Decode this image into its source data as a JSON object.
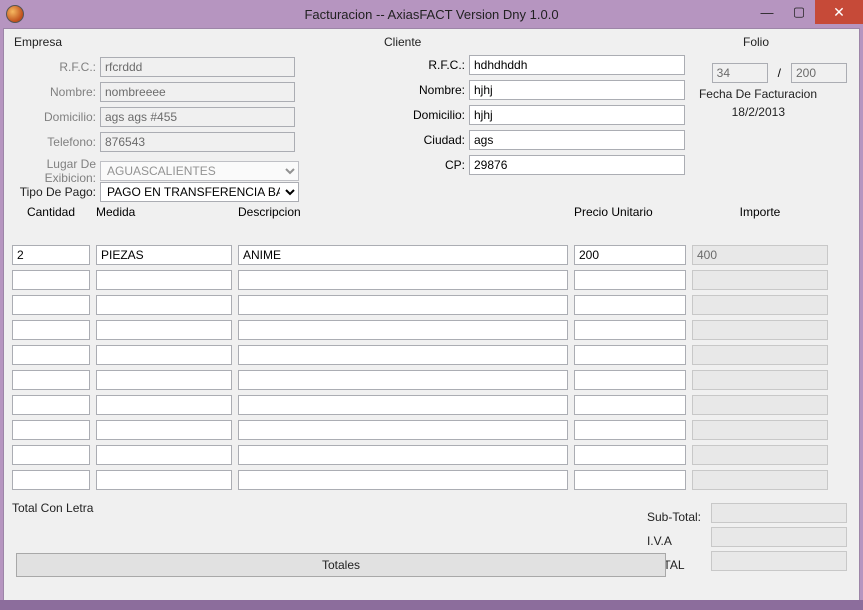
{
  "window": {
    "title": "Facturacion -- AxiasFACT Version Dny 1.0.0"
  },
  "empresa": {
    "heading": "Empresa",
    "rfc_label": "R.F.C.:",
    "rfc": "rfcrddd",
    "nombre_label": "Nombre:",
    "nombre": "nombreeee",
    "domicilio_label": "Domicilio:",
    "domicilio": "ags ags #455",
    "telefono_label": "Telefono:",
    "telefono": "876543",
    "lugar_label": "Lugar De Exibicion:",
    "lugar": "AGUASCALIENTES",
    "tipo_pago_label": "Tipo De Pago:",
    "tipo_pago": "PAGO EN TRANSFERENCIA BANC"
  },
  "cliente": {
    "heading": "Cliente",
    "rfc_label": "R.F.C.:",
    "rfc": "hdhdhddh",
    "nombre_label": "Nombre:",
    "nombre": "hjhj",
    "domicilio_label": "Domicilio:",
    "domicilio": "hjhj",
    "ciudad_label": "Ciudad:",
    "ciudad": "ags",
    "cp_label": "CP:",
    "cp": "29876"
  },
  "folio": {
    "heading": "Folio",
    "a": "34",
    "sep": "/",
    "b": "200",
    "fecha_label": "Fecha De Facturacion",
    "fecha": "18/2/2013"
  },
  "table": {
    "headers": {
      "cantidad": "Cantidad",
      "medida": "Medida",
      "descripcion": "Descripcion",
      "precio_unitario": "Precio Unitario",
      "importe": "Importe"
    },
    "rows": [
      {
        "cantidad": "2",
        "medida": "PIEZAS",
        "descripcion": "ANIME",
        "precio_unitario": "200",
        "importe": "400"
      },
      {
        "cantidad": "",
        "medida": "",
        "descripcion": "",
        "precio_unitario": "",
        "importe": ""
      },
      {
        "cantidad": "",
        "medida": "",
        "descripcion": "",
        "precio_unitario": "",
        "importe": ""
      },
      {
        "cantidad": "",
        "medida": "",
        "descripcion": "",
        "precio_unitario": "",
        "importe": ""
      },
      {
        "cantidad": "",
        "medida": "",
        "descripcion": "",
        "precio_unitario": "",
        "importe": ""
      },
      {
        "cantidad": "",
        "medida": "",
        "descripcion": "",
        "precio_unitario": "",
        "importe": ""
      },
      {
        "cantidad": "",
        "medida": "",
        "descripcion": "",
        "precio_unitario": "",
        "importe": ""
      },
      {
        "cantidad": "",
        "medida": "",
        "descripcion": "",
        "precio_unitario": "",
        "importe": ""
      },
      {
        "cantidad": "",
        "medida": "",
        "descripcion": "",
        "precio_unitario": "",
        "importe": ""
      },
      {
        "cantidad": "",
        "medida": "",
        "descripcion": "",
        "precio_unitario": "",
        "importe": ""
      }
    ]
  },
  "footer": {
    "total_con_letra": "Total Con Letra",
    "subtotal_label": "Sub-Total:",
    "iva_label": "I.V.A",
    "total_label": "TOTAL",
    "subtotal": "",
    "iva": "",
    "total": "",
    "totales_btn": "Totales"
  }
}
